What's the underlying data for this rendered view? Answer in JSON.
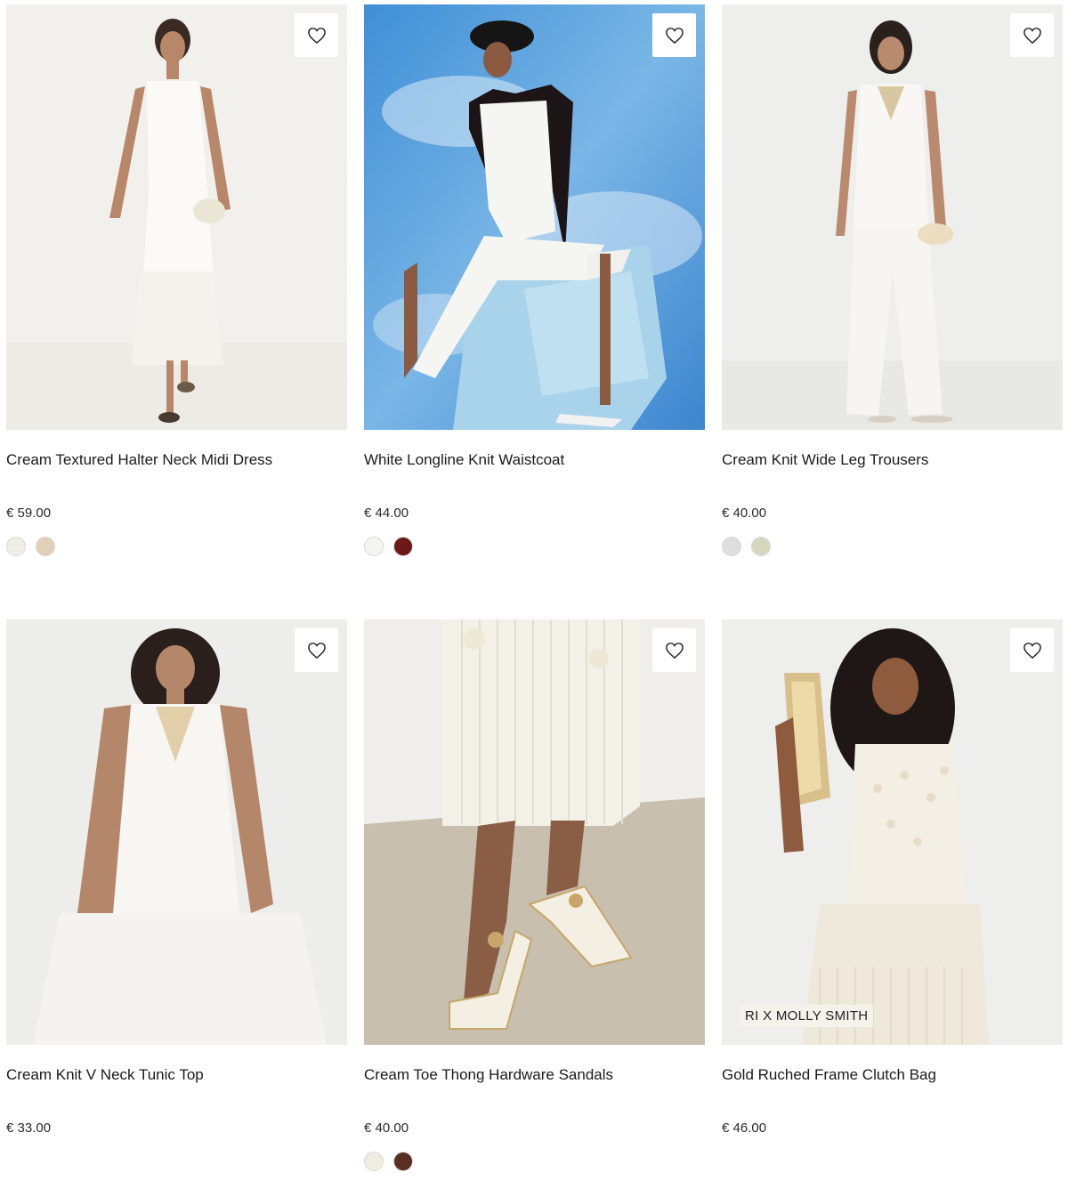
{
  "products": [
    {
      "name": "Cream Textured Halter Neck Midi Dress",
      "price": "€ 59.00",
      "wishlist_icon": "heart-icon",
      "badge": "",
      "swatches": [
        "#eeede6",
        "#e1cfb8"
      ]
    },
    {
      "name": "White Longline Knit Waistcoat",
      "price": "€ 44.00",
      "wishlist_icon": "heart-icon",
      "badge": "",
      "swatches": [
        "#f4f4f2",
        "#6b1a17"
      ]
    },
    {
      "name": "Cream Knit Wide Leg Trousers",
      "price": "€ 40.00",
      "wishlist_icon": "heart-icon",
      "badge": "",
      "swatches": [
        "#dededf",
        "#d5d8bf"
      ]
    },
    {
      "name": "Cream Knit V Neck Tunic Top",
      "price": "€ 33.00",
      "wishlist_icon": "heart-icon",
      "badge": "",
      "swatches": []
    },
    {
      "name": "Cream Toe Thong Hardware Sandals",
      "price": "€ 40.00",
      "wishlist_icon": "heart-icon",
      "badge": "",
      "swatches": [
        "#efece2",
        "#5a2e23"
      ]
    },
    {
      "name": "Gold Ruched Frame Clutch Bag",
      "price": "€ 46.00",
      "wishlist_icon": "heart-icon",
      "badge": "RI X MOLLY SMITH",
      "swatches": []
    }
  ]
}
